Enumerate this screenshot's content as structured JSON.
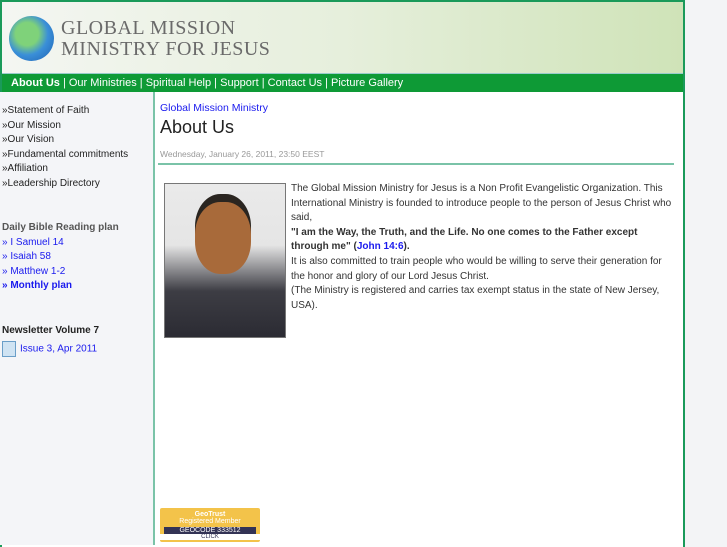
{
  "header": {
    "logo_line1": "GLOBAL MISSION",
    "logo_line2": "MINISTRY FOR JESUS"
  },
  "nav": [
    "About Us",
    "Our Ministries",
    "Spiritual Help",
    "Support",
    "Contact Us",
    "Picture Gallery"
  ],
  "sidebar": {
    "links": [
      "»Statement of Faith",
      "»Our Mission",
      "»Our Vision",
      "»Fundamental commitments",
      "»Affiliation",
      "»Leadership Directory"
    ],
    "bible_heading": "Daily Bible Reading plan",
    "bible": [
      "» I Samuel 14",
      "» Isaiah 58",
      "» Matthew 1-2"
    ],
    "monthly": "» Monthly plan",
    "newsletter_heading": "Newsletter Volume 7",
    "newsletter_item": "Issue 3, Apr 2011"
  },
  "main": {
    "breadcrumb": "Global Mission Ministry",
    "title": "About Us",
    "date": "Wednesday, January 26, 2011, 23:50 EEST",
    "p1": "The Global Mission Ministry for Jesus is a Non Profit Evangelistic Organization. This International Ministry is founded to introduce people to the person of Jesus Christ who said,",
    "quote": "\"I am the Way, the Truth, and the Life. No one comes to the Father except through me\" (",
    "ref": "John 14:6",
    "quote_end": ").",
    "p2": "It is also committed to train people who would be willing to serve their generation for the honor and glory of our Lord Jesus Christ.",
    "p3": "(The Ministry is registered and carries tax exempt status in the state of New Jersey, USA)."
  },
  "badge": {
    "line1": "GeoTrust",
    "line2": "Registered Member",
    "line3": "GEOCODE 333512",
    "click": "CLICK"
  }
}
